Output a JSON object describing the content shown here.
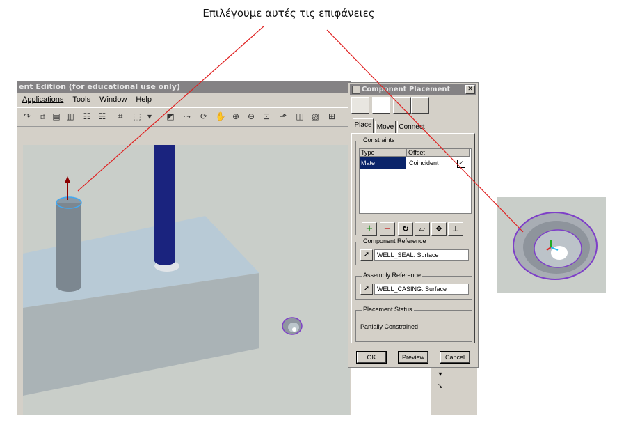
{
  "caption": "Επιλέγουμε αυτές τις επιφάνειες",
  "app": {
    "title": "ent Edition (for educational use only)",
    "menu": [
      "Applications",
      "Tools",
      "Window",
      "Help"
    ]
  },
  "dialog": {
    "title": "Component Placement",
    "close_icon": "close-icon",
    "tabs": [
      "Place",
      "Move",
      "Connect"
    ],
    "active_tab": "Place",
    "constraints": {
      "label": "Constraints",
      "columns": [
        "Type",
        "Offset"
      ],
      "rows": [
        {
          "type": "Mate",
          "offset": "Coincident",
          "checked": true
        }
      ]
    },
    "component_reference": {
      "label": "Component Reference",
      "value": "WELL_SEAL: Surface"
    },
    "assembly_reference": {
      "label": "Assembly Reference",
      "value": "WELL_CASING: Surface"
    },
    "placement_status": {
      "label": "Placement Status",
      "value": "Partially Constrained"
    },
    "buttons": {
      "ok": "OK",
      "preview": "Preview",
      "cancel": "Cancel"
    }
  },
  "colors": {
    "callout_line": "#e02020",
    "selection_highlight": "#7e3fc8",
    "viewport_bg": "#c9cec9",
    "rod_blue": "#1a237e",
    "list_selection": "#0a246a"
  }
}
